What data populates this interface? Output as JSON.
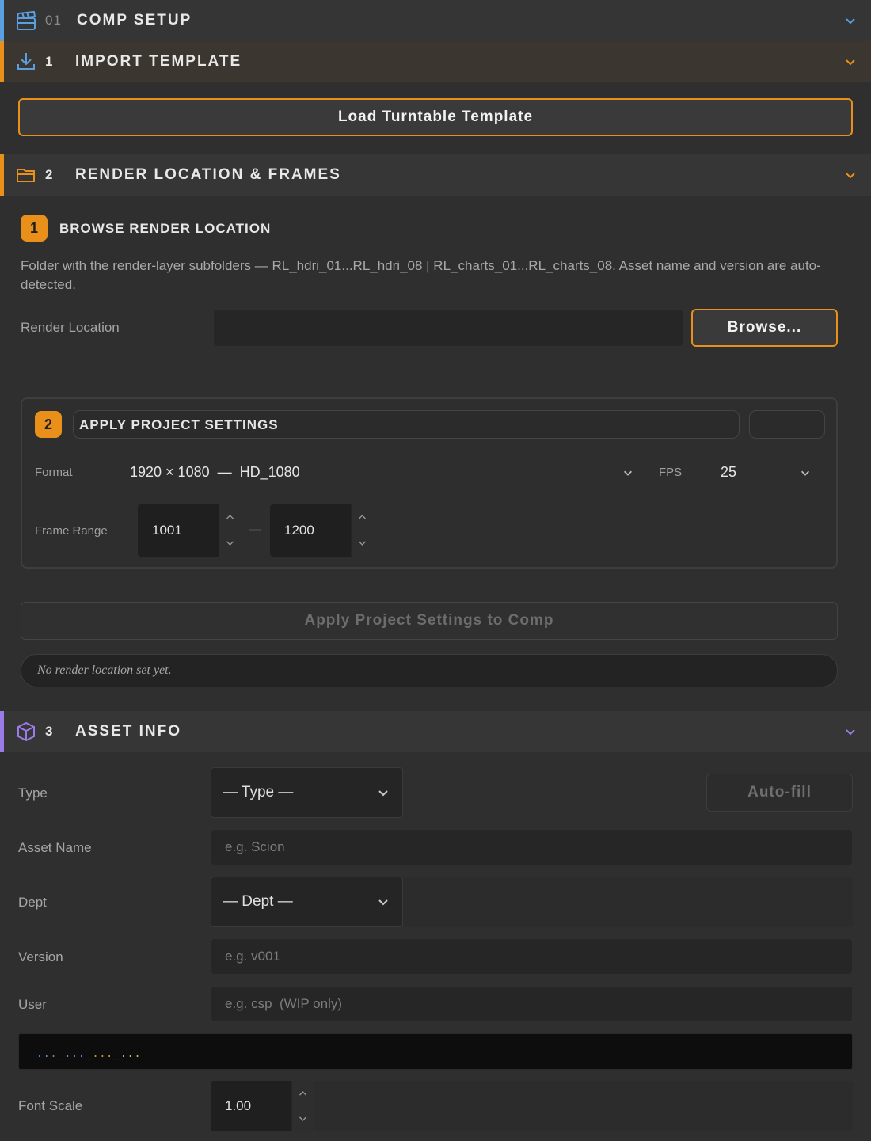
{
  "sections": {
    "comp_setup": {
      "number": "01",
      "title": "COMP SETUP",
      "icon": "clapperboard-icon"
    },
    "import_template": {
      "number": "1",
      "title": "IMPORT TEMPLATE",
      "icon": "download-icon",
      "button": "Load Turntable Template"
    },
    "render_location": {
      "number": "2",
      "title": "RENDER LOCATION & FRAMES",
      "icon": "folder-icon"
    },
    "asset_info": {
      "number": "3",
      "title": "ASSET INFO",
      "icon": "cube-icon"
    }
  },
  "browse": {
    "step": "1",
    "title": "BROWSE RENDER LOCATION",
    "description": "Folder with the render-layer subfolders — RL_hdri_01...RL_hdri_08 | RL_charts_01...RL_charts_08. Asset name and version are auto-detected.",
    "location_label": "Render Location",
    "location_value": "",
    "browse_button": "Browse..."
  },
  "project": {
    "step": "2",
    "title": "APPLY PROJECT SETTINGS",
    "format_label": "Format",
    "format_value": "1920 × 1080  —  HD_1080",
    "fps_label": "FPS",
    "fps_value": "25",
    "frame_range_label": "Frame Range",
    "frame_start": "1001",
    "frame_sep": "—",
    "frame_end": "1200",
    "apply_button": "Apply Project Settings to Comp",
    "status": "No render location set yet."
  },
  "asset": {
    "type_label": "Type",
    "type_value": "— Type —",
    "autofill_button": "Auto-fill",
    "name_label": "Asset Name",
    "name_placeholder": "e.g. Scion",
    "dept_label": "Dept",
    "dept_value": "— Dept —",
    "version_label": "Version",
    "version_placeholder": "e.g. v001",
    "user_label": "User",
    "user_placeholder": "e.g. csp  (WIP only)",
    "preview_parts": [
      "...",
      "_",
      "...",
      "_",
      "...",
      "_",
      "..."
    ],
    "font_scale_label": "Font Scale",
    "font_scale_value": "1.00"
  },
  "colors": {
    "accent_orange": "#e8901a",
    "accent_blue": "#5aa0e0",
    "accent_purple": "#9b7be8",
    "background": "#2f2f2f"
  }
}
